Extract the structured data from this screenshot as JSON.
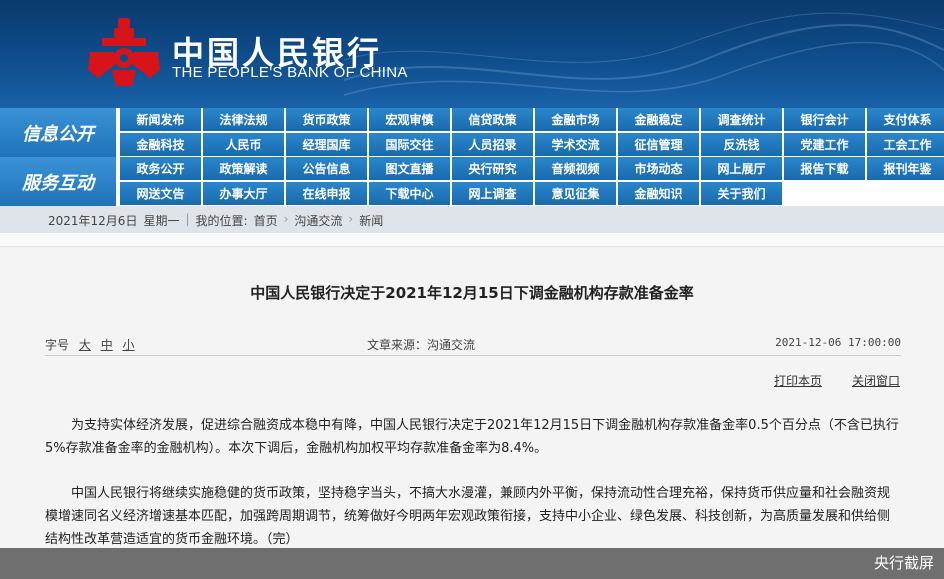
{
  "header": {
    "name_cn": "中国人民银行",
    "name_en": "THE PEOPLE'S BANK OF CHINA",
    "brand_color": "#0e4d8c",
    "emblem_color": "#d7141a"
  },
  "nav": {
    "sections": [
      {
        "label": "信息公开",
        "rows": [
          [
            "新闻发布",
            "法律法规",
            "货币政策",
            "宏观审慎",
            "信贷政策",
            "金融市场",
            "金融稳定",
            "调查统计",
            "银行会计",
            "支付体系"
          ],
          [
            "金融科技",
            "人民币",
            "经理国库",
            "国际交往",
            "人员招录",
            "学术交流",
            "征信管理",
            "反洗钱",
            "党建工作",
            "工会工作"
          ]
        ]
      },
      {
        "label": "服务互动",
        "rows": [
          [
            "政务公开",
            "政策解读",
            "公告信息",
            "图文直播",
            "央行研究",
            "音频视频",
            "市场动态",
            "网上展厅",
            "报告下载",
            "报刊年鉴"
          ],
          [
            "网送文告",
            "办事大厅",
            "在线申报",
            "下载中心",
            "网上调查",
            "意见征集",
            "金融知识",
            "关于我们"
          ]
        ]
      }
    ]
  },
  "breadcrumb": {
    "date": "2021年12月6日",
    "weekday": "星期一",
    "location_label": "我的位置:",
    "items": [
      "首页",
      "沟通交流",
      "新闻"
    ]
  },
  "article": {
    "title": "中国人民银行决定于2021年12月15日下调金融机构存款准备金率",
    "font_label": "字号",
    "font_sizes": [
      "大",
      "中",
      "小"
    ],
    "source": "文章来源：沟通交流",
    "timestamp": "2021-12-06 17:00:00",
    "print_label": "打印本页",
    "close_label": "关闭窗口",
    "paragraphs": [
      "为支持实体经济发展，促进综合融资成本稳中有降，中国人民银行决定于2021年12月15日下调金融机构存款准备金率0.5个百分点（不含已执行5%存款准备金率的金融机构）。本次下调后，金融机构加权平均存款准备金率为8.4%。",
      "中国人民银行将继续实施稳健的货币政策，坚持稳字当头，不搞大水漫灌，兼顾内外平衡，保持流动性合理充裕，保持货币供应量和社会融资规模增速同名义经济增速基本匹配，加强跨周期调节，统筹做好今明两年宏观政策衔接，支持中小企业、绿色发展、科技创新，为高质量发展和供给侧结构性改革营造适宜的货币金融环境。（完）"
    ]
  },
  "watermark": "央行截屏"
}
